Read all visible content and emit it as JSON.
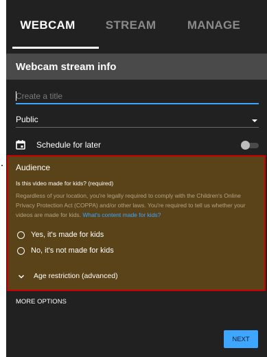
{
  "tabs": [
    {
      "label": "WEBCAM",
      "active": true
    },
    {
      "label": "STREAM",
      "active": false
    },
    {
      "label": "MANAGE",
      "active": false
    }
  ],
  "section": {
    "title": "Webcam stream info"
  },
  "title_input": {
    "placeholder": "Create a title",
    "value": ""
  },
  "visibility": {
    "selected": "Public"
  },
  "schedule": {
    "label": "Schedule for later",
    "enabled": false,
    "icon": "calendar-icon"
  },
  "audience": {
    "title": "Audience",
    "question": "Is this video made for kids? (required)",
    "description": "Regardless of your location, you're legally required to comply with the Children's Online Privacy Protection Act (COPPA) and/or other laws. You're required to tell us whether your videos are made for kids. ",
    "link": "What's content made for kids?",
    "options": [
      {
        "label": "Yes, it's made for kids",
        "selected": false
      },
      {
        "label": "No, it's not made for kids",
        "selected": false
      }
    ],
    "age_restriction": {
      "label": "Age restriction (advanced)",
      "icon": "chevron-down-icon"
    }
  },
  "more_options": {
    "label": "MORE OPTIONS"
  },
  "next_button": {
    "label": "NEXT"
  },
  "colors": {
    "panel_bg": "#212121",
    "header_bg": "#4a4a4a",
    "accent": "#3ea6ff",
    "highlight_border": "#cc0000",
    "highlight_bg": "#5a4318"
  }
}
